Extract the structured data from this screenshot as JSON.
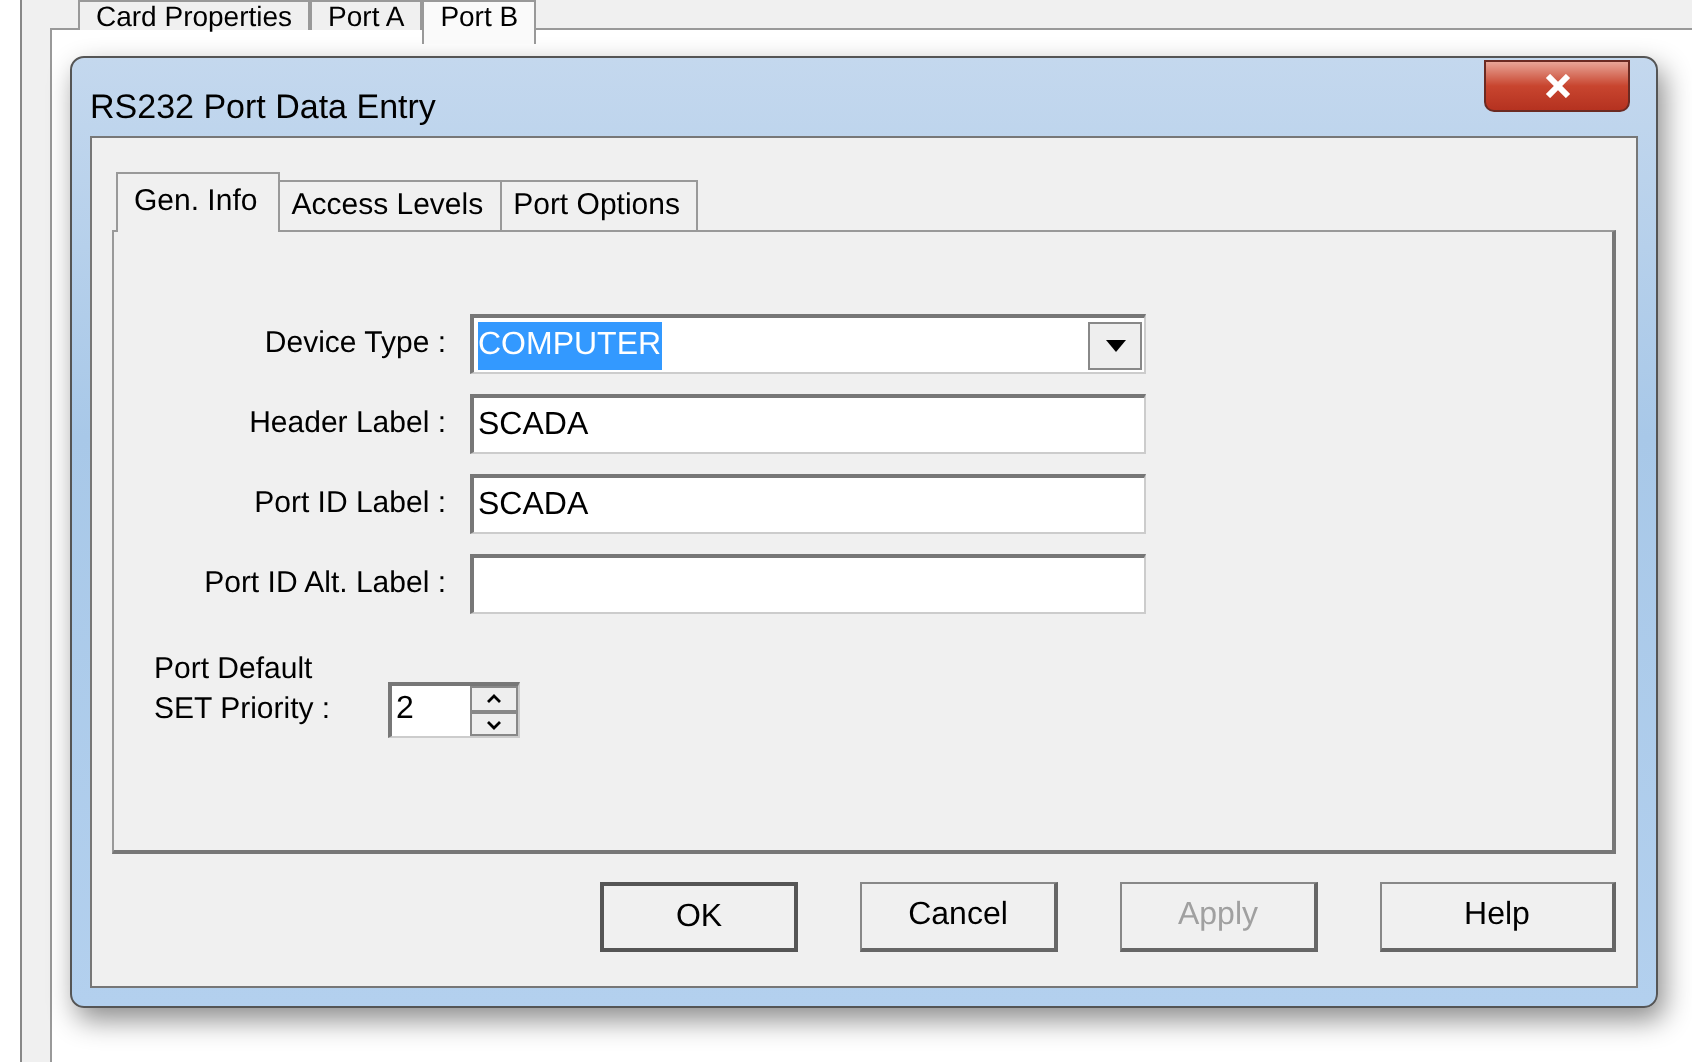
{
  "parent_window": {
    "tabs": [
      {
        "label": "Card Properties",
        "selected": false
      },
      {
        "label": "Port A",
        "selected": false
      },
      {
        "label": "Port B",
        "selected": true
      }
    ]
  },
  "dialog": {
    "title": "RS232 Port Data Entry",
    "tabs": [
      {
        "label": "Gen. Info",
        "selected": true
      },
      {
        "label": "Access Levels",
        "selected": false
      },
      {
        "label": "Port Options",
        "selected": false
      }
    ],
    "fields": [
      {
        "kind": "dropdown",
        "label": "Device Type :",
        "value": "COMPUTER",
        "text_selected": true
      },
      {
        "kind": "text",
        "label": "Header Label :",
        "value": "SCADA"
      },
      {
        "kind": "text",
        "label": "Port ID Label :",
        "value": "SCADA"
      },
      {
        "kind": "text",
        "label": "Port ID Alt. Label :"
      },
      {
        "kind": "spinner",
        "label": "Port Default\nSET Priority :",
        "value": "2"
      }
    ],
    "buttons": [
      {
        "label": "OK",
        "default": true,
        "disabled": false
      },
      {
        "label": "Cancel",
        "default": false,
        "disabled": false
      },
      {
        "label": "Apply",
        "default": false,
        "disabled": true
      },
      {
        "label": "Help",
        "default": false,
        "disabled": false
      }
    ]
  }
}
